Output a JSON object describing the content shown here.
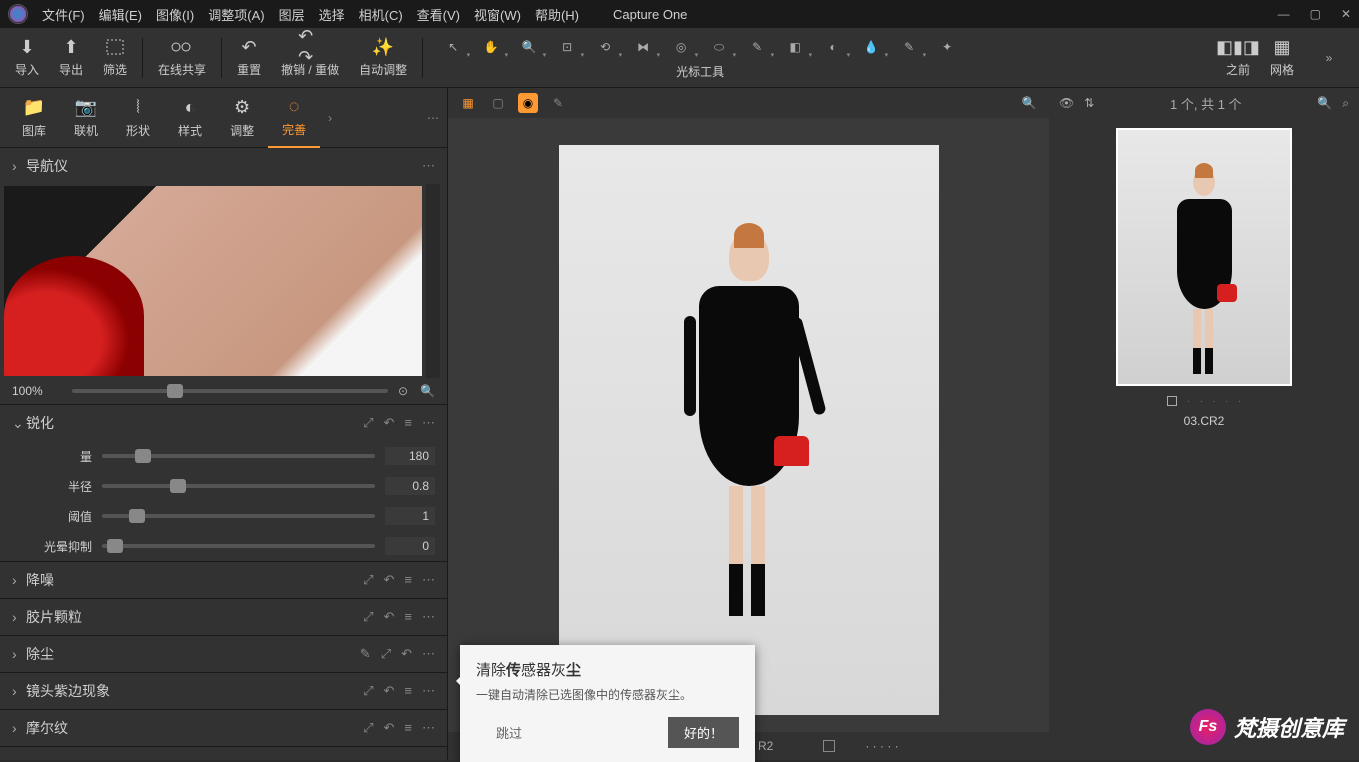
{
  "app": {
    "name": "Capture One"
  },
  "menu": [
    "文件(F)",
    "编辑(E)",
    "图像(I)",
    "调整项(A)",
    "图层",
    "选择",
    "相机(C)",
    "查看(V)",
    "视窗(W)",
    "帮助(H)"
  ],
  "toolbar": {
    "import": "导入",
    "export": "导出",
    "filter": "筛选",
    "share": "在线共享",
    "reset": "重置",
    "undo_redo": "撤销 / 重做",
    "auto": "自动调整",
    "cursor_label": "光标工具",
    "before": "之前",
    "grid": "网格"
  },
  "tabs": [
    "图库",
    "联机",
    "形状",
    "样式",
    "调整",
    "完善"
  ],
  "sections": {
    "navigator": "导航仪",
    "sharpen": {
      "title": "锐化",
      "amount_label": "量",
      "amount": "180",
      "radius_label": "半径",
      "radius": "0.8",
      "threshold_label": "阈值",
      "threshold": "1",
      "halo_label": "光晕抑制",
      "halo": "0"
    },
    "noise": "降噪",
    "film": "胶片颗粒",
    "dust": "除尘",
    "purple": "镜头紫边现象",
    "moire": "摩尔纹"
  },
  "zoom": "100%",
  "browser": {
    "count": "1 个, 共 1 个",
    "filename": "03.CR2"
  },
  "viewer_footer": {
    "ext": "R2"
  },
  "tooltip": {
    "title_pre": "清除",
    "title_b1": "传",
    "title_mid": "感器灰",
    "title_b2": "尘",
    "desc": "一键自动清除已选图像中的传感器灰尘。",
    "skip": "跳过",
    "ok": "好的！"
  },
  "watermark": {
    "logo": "Fs",
    "text": "梵摄创意库"
  }
}
